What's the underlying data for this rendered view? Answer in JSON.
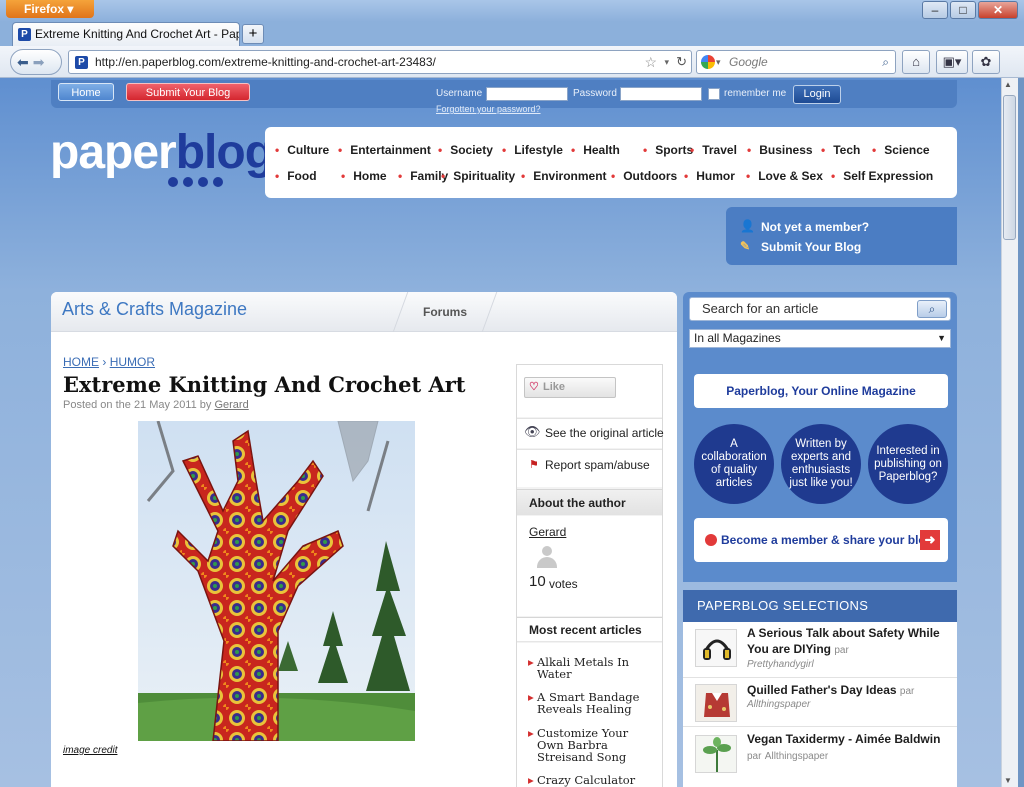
{
  "browser": {
    "app_button": "Firefox",
    "tab_title": "Extreme Knitting And Crochet Art - Pape...",
    "url": "http://en.paperblog.com/extreme-knitting-and-crochet-art-23483/",
    "search_placeholder": "Google"
  },
  "header": {
    "home_label": "Home",
    "submit_label": "Submit Your Blog",
    "username_label": "Username",
    "password_label": "Password",
    "remember_label": "remember me",
    "login_label": "Login",
    "forgot_label": "Forgotten your password?"
  },
  "logo": {
    "part1": "paper",
    "part2": "blog"
  },
  "categories_row1": [
    "Culture",
    "Entertainment",
    "Society",
    "Lifestyle",
    "Health",
    "Sports",
    "Travel",
    "Business",
    "Tech",
    "Science"
  ],
  "categories_row2": [
    "Food",
    "Home",
    "Family",
    "Spirituality",
    "Environment",
    "Outdoors",
    "Humor",
    "Love & Sex",
    "Self Expression"
  ],
  "member": {
    "not_member": "Not yet a member?",
    "submit": "Submit Your Blog"
  },
  "main": {
    "magazine_title": "Arts & Crafts Magazine",
    "forums_tab": "Forums",
    "breadcrumb_home": "HOME",
    "breadcrumb_sep": "›",
    "breadcrumb_cat": "HUMOR",
    "article_title": "Extreme Knitting And Crochet Art",
    "posted_prefix": "Posted on the 21 May 2011 by",
    "author": "Gerard",
    "image_credit": "image credit"
  },
  "side": {
    "like_label": "Like",
    "see_original": "See the original article",
    "report_spam": "Report spam/abuse",
    "about_author": "About the author",
    "author_name": "Gerard",
    "votes_number": "10",
    "votes_label": "votes",
    "recent_heading": "Most recent articles",
    "recent_articles": [
      "Alkali Metals In Water",
      "A Smart Bandage Reveals Healing",
      "Customize Your Own Barbra Streisand Song",
      "Crazy Calculator"
    ]
  },
  "right": {
    "search_placeholder": "Search for an article",
    "magazine_select": "In all Magazines",
    "promo_title": "Paperblog, Your Online Magazine",
    "circles": [
      "A collaboration of quality articles",
      "Written by experts and enthusiasts just like you!",
      "Interested in publishing on Paperblog?"
    ],
    "become_member": "Become a member & share your blog",
    "selections_heading": "PAPERBLOG SELECTIONS",
    "selections": [
      {
        "title": "A Serious Talk about Safety While You are DIYing",
        "by": "par",
        "blog": "Prettyhandygirl"
      },
      {
        "title": "Quilled Father's Day Ideas",
        "by": "par",
        "blog": "Allthingspaper"
      },
      {
        "title": "Vegan Taxidermy - Aimée Baldwin",
        "by": "par",
        "blog": "Allthingspaper"
      }
    ]
  },
  "colors": {
    "brand_blue": "#1f3c9c",
    "accent_red": "#e23a3a",
    "page_blue": "#5b8bcc"
  }
}
